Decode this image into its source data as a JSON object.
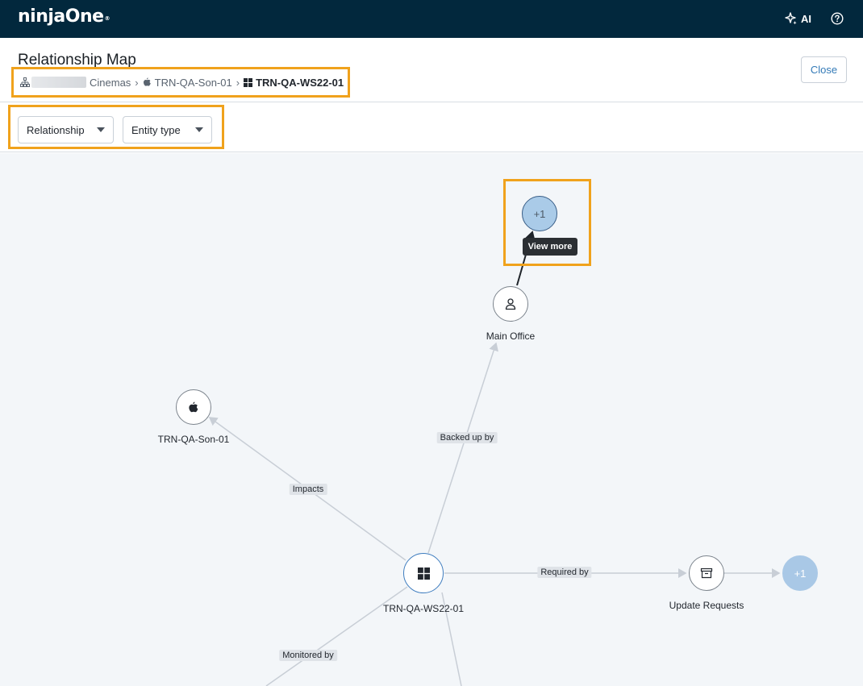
{
  "app": {
    "logo": "ninjaOne",
    "logo_mark": "®",
    "ai_label": "AI"
  },
  "header": {
    "title": "Relationship Map",
    "breadcrumb": {
      "org": "Cinemas",
      "device": "TRN-QA-Son-01",
      "current": "TRN-QA-WS22-01",
      "sep": "›"
    },
    "close_label": "Close"
  },
  "filters": {
    "relationship": "Relationship",
    "entity_type": "Entity type"
  },
  "map": {
    "tooltip": "View more",
    "nodes": {
      "more_top": "+1",
      "main_office": "Main Office",
      "son": "TRN-QA-Son-01",
      "ws22": "TRN-QA-WS22-01",
      "update_requests": "Update Requests",
      "more_right": "+1"
    },
    "edges": {
      "backed_up_by": "Backed up by",
      "impacts": "Impacts",
      "required_by": "Required by",
      "monitored_by": "Monitored by"
    }
  },
  "colors": {
    "topbar": "#02283d",
    "highlight": "#f0a21c",
    "link": "#337ab7",
    "more_node": "#a9c8e6"
  }
}
